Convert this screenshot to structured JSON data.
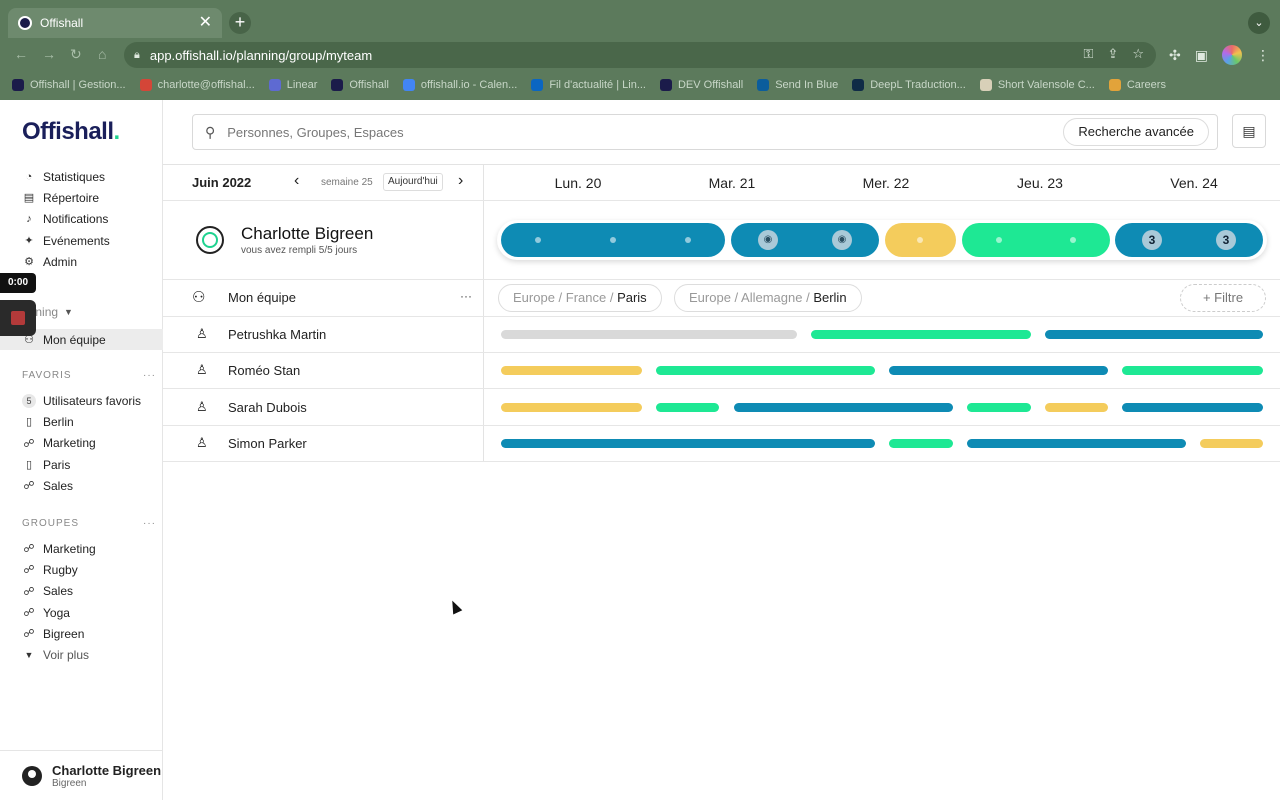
{
  "browser": {
    "tab_title": "Offishall",
    "tab_close": "✕",
    "new_tab": "+",
    "url": "app.offishall.io/planning/group/myteam",
    "bookmarks": [
      {
        "label": "Offishall | Gestion...",
        "color": "#1b1b4a"
      },
      {
        "label": "charlotte@offishal...",
        "color": "#d44638"
      },
      {
        "label": "Linear",
        "color": "#5e6ad2"
      },
      {
        "label": "Offishall",
        "color": "#1b1b4a"
      },
      {
        "label": "offishall.io - Calen...",
        "color": "#4285f4"
      },
      {
        "label": "Fil d'actualité | Lin...",
        "color": "#0a66c2"
      },
      {
        "label": "DEV Offishall",
        "color": "#1b1b4a"
      },
      {
        "label": "Send In Blue",
        "color": "#0b5d9c"
      },
      {
        "label": "DeepL Traduction...",
        "color": "#0f2b46"
      },
      {
        "label": "Short Valensole C...",
        "color": "#d8d0b8"
      },
      {
        "label": "Careers",
        "color": "#e2a33a"
      }
    ]
  },
  "app": {
    "logo": "Offishall",
    "logo_dot": ".",
    "nav": [
      {
        "label": "Statistiques",
        "icon": "◔"
      },
      {
        "label": "Répertoire",
        "icon": "▤"
      },
      {
        "label": "Notifications",
        "icon": "♫"
      },
      {
        "label": "Evénements",
        "icon": "✦"
      },
      {
        "label": "Admin",
        "icon": "⚙"
      }
    ],
    "planning_label": "anning",
    "active_item": "Mon équipe",
    "favorites_title": "FAVORIS",
    "favorites": [
      {
        "label": "Utilisateurs favoris",
        "badge": "5"
      },
      {
        "label": "Berlin",
        "icon": "▯"
      },
      {
        "label": "Marketing",
        "icon": "☍"
      },
      {
        "label": "Paris",
        "icon": "▯"
      },
      {
        "label": "Sales",
        "icon": "☍"
      }
    ],
    "groups_title": "GROUPES",
    "groups": [
      "Marketing",
      "Rugby",
      "Sales",
      "Yoga",
      "Bigreen"
    ],
    "see_more": "Voir plus",
    "section_more": "···",
    "user": {
      "name": "Charlotte Bigreen",
      "org": "Bigreen"
    },
    "rec_time": "0:00"
  },
  "search": {
    "placeholder": "Personnes, Groupes, Espaces",
    "advanced": "Recherche avancée"
  },
  "calendar": {
    "month": "Juin 2022",
    "week": "semaine 25",
    "today": "Aujourd'hui",
    "days": [
      "Lun. 20",
      "Mar. 21",
      "Mer. 22",
      "Jeu. 23",
      "Ven. 24"
    ]
  },
  "me": {
    "name": "Charlotte Bigreen",
    "subtitle": "vous avez rempli 5/5 jours",
    "remote_count_thursday": "3",
    "remote_count_friday": "3"
  },
  "team": {
    "name": "Mon équipe",
    "more": "···",
    "locations": [
      {
        "prefix": "Europe / France / ",
        "last": "Paris"
      },
      {
        "prefix": "Europe / Allemagne / ",
        "last": "Berlin"
      }
    ],
    "filter": "+ Filtre",
    "members": [
      "Petrushka Martin",
      "Roméo Stan",
      "Sarah Dubois",
      "Simon Parker"
    ]
  },
  "colors": {
    "blue": "#0e8bb4",
    "green": "#1ee894",
    "yellow": "#f4cc5c",
    "gray": "#d9d9d9"
  }
}
